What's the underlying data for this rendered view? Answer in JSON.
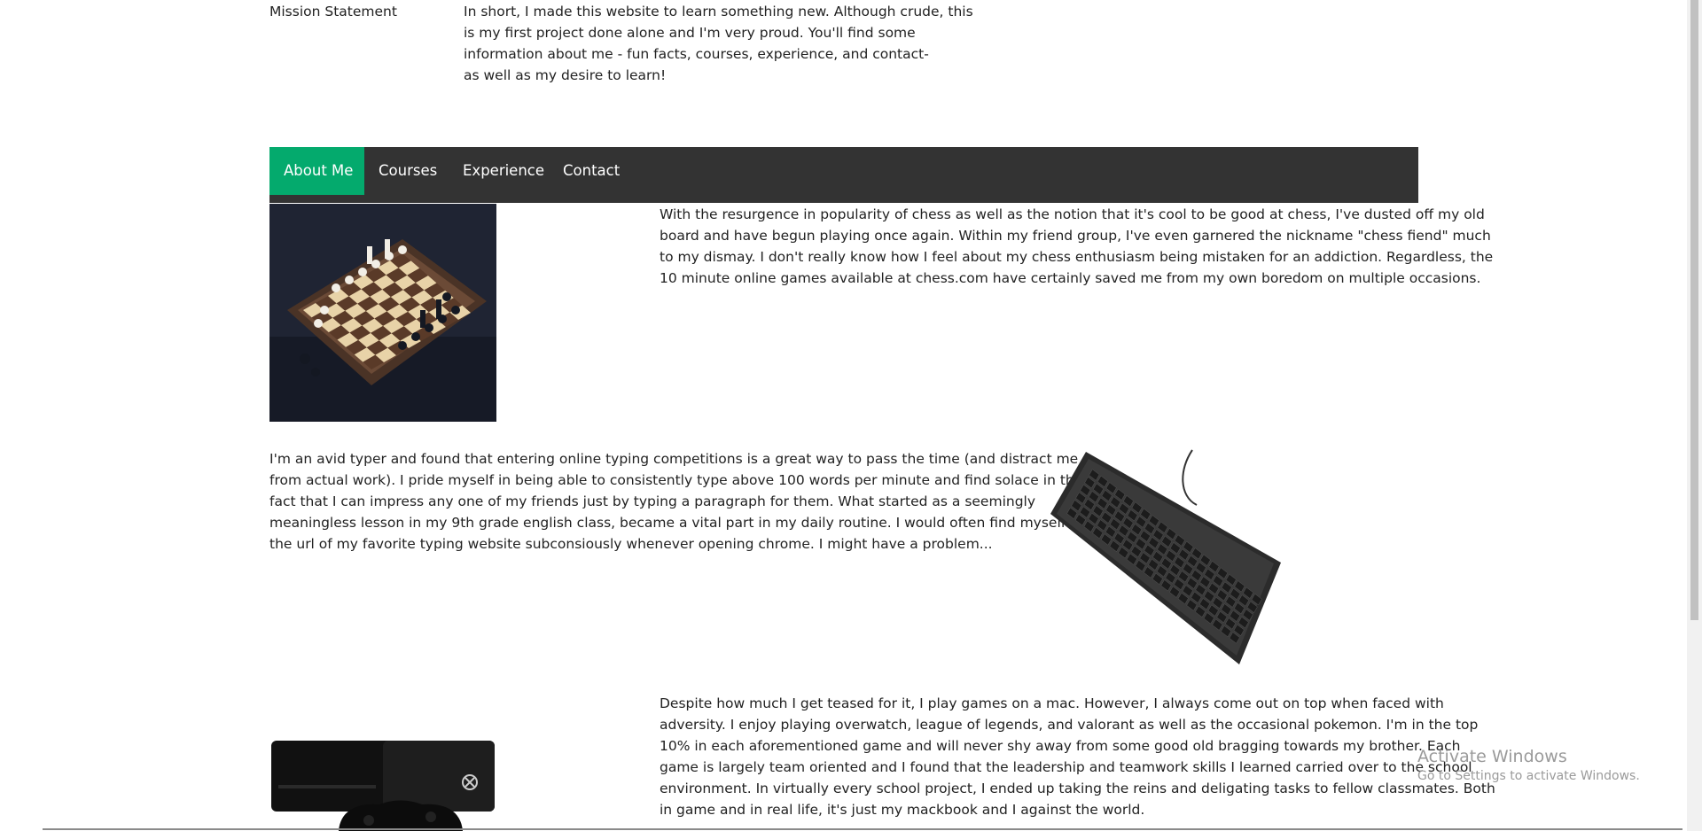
{
  "mission": {
    "label": "Mission Statement",
    "lines": [
      "In short, I made this website to learn something new. Although crude, this",
      "is my first project done alone and I'm very proud. You'll find some",
      "information about me - fun facts, courses, experience, and contact-",
      "as well as my desire to learn!"
    ]
  },
  "nav": {
    "items": [
      {
        "label": "About Me",
        "active": true
      },
      {
        "label": "Courses"
      },
      {
        "label": "Experience"
      },
      {
        "label": "Contact"
      }
    ],
    "active_color": "#04aa6d",
    "bar_color": "#333333"
  },
  "sections": [
    {
      "image": "chess-board-image",
      "lines": [
        "With the resurgence in popularity of chess as well as the notion that it's cool to be good at chess, I've dusted off my old",
        "board and have begun playing once again. Within my friend group, I've even garnered the nickname \"chess fiend\" much",
        "to my dismay. I don't really know how I feel about my chess enthusiasm being mistaken for an addiction. Regardless, the",
        "10 minute online games available at chess.com have certainly saved me from my own boredom on multiple occasions."
      ]
    },
    {
      "image": "keyboard-image",
      "lines": [
        "I'm an avid typer and found that entering online typing competitions is a great way to pass the time (and distract me",
        "from actual work). I pride myself in being able to consistently type above 100 words per minute and find solace in the",
        "fact that I can impress any one of my friends just by typing a paragraph for them. What started as a seemingly",
        "meaningless lesson in my 9th grade english class, became a vital part in my daily routine. I would often find myself typing",
        "the url of my favorite typing website subconsiously whenever opening chrome. I might have a problem..."
      ]
    },
    {
      "image": "xbox-console-image",
      "lines": [
        "Despite how much I get teased for it, I play games on a mac. However, I always come out on top when faced with",
        "adversity. I enjoy playing overwatch, league of legends, and valorant as well as the occasional pokemon. I'm in the top",
        "10% in each aforementioned game and will never shy away from some good old bragging towards my brother. Each",
        "game is largely team oriented and I found that the leadership and teamwork skills I learned carried over to the school",
        "environment. In virtually every school project, I ended up taking the reins and deligating tasks to fellow classmates. Both",
        "in game and in real life, it's just my mackbook and I against the world."
      ]
    }
  ],
  "watermark": {
    "title": "Activate Windows",
    "subtitle": "Go to Settings to activate Windows."
  }
}
